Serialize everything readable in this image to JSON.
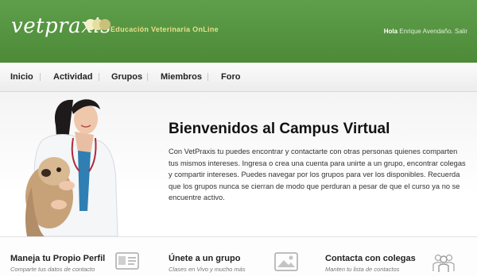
{
  "header": {
    "logo_text": "vetpraxis",
    "tagline": "Educación Veterinaria OnLine",
    "greeting": "Hola",
    "user_name": "Enrique Avendaño.",
    "logout_label": "Salir",
    "colors": {
      "bar": "#4c8a38",
      "tagline": "#e8df8a",
      "dot1": "#f3f0c9",
      "dot2": "#e6dea0",
      "dot3": "#c9c07a"
    }
  },
  "nav": {
    "items": [
      {
        "label": "Inicio"
      },
      {
        "label": "Actividad"
      },
      {
        "label": "Grupos"
      },
      {
        "label": "Miembros"
      },
      {
        "label": "Foro"
      }
    ]
  },
  "hero": {
    "title": "Bienvenidos al Campus Virtual",
    "text": "Con VetPraxis tu puedes encontrar y contactarte con otras personas quienes comparten tus mismos intereses. Ingresa o crea una cuenta para unirte a un grupo, encontrar colegas y compartir intereses. Puedes navegar por los grupos para ver los disponibles. Recuerda que los grupos nunca se cierran de modo que perduran a pesar de que el curso ya no se encuentre activo.",
    "image_icon": "veterinarian-with-dog-photo"
  },
  "features": [
    {
      "title": "Maneja tu Propio Perfil",
      "subtitle": "Comparte tus datos de contacto",
      "icon": "profile-card-icon"
    },
    {
      "title": "Únete a un grupo",
      "subtitle": "Clases en Vivo y mucho más",
      "icon": "image-frame-icon"
    },
    {
      "title": "Contacta con colegas",
      "subtitle": "Manten tu lista de contactos",
      "icon": "people-group-icon"
    }
  ]
}
